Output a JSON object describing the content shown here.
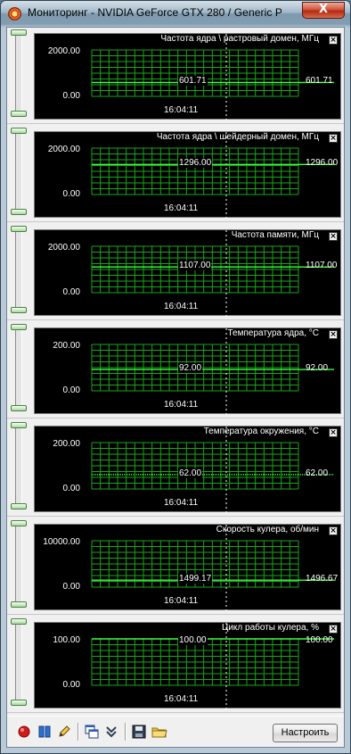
{
  "window": {
    "title": "Мониторинг - NVIDIA GeForce GTX 280 / Generic P...",
    "close_symbol": "X"
  },
  "graphs": [
    {
      "title": "Частота ядра \\ растровый домен, МГц",
      "max": "2000.00",
      "min": "0.00",
      "current": "601.71",
      "right_value": "601.71",
      "time": "16:04:11",
      "line_level": 0.3,
      "cursor_pos": 0.5,
      "dotted": false
    },
    {
      "title": "Частота ядра \\ шейдерный домен, МГц",
      "max": "2000.00",
      "min": "0.00",
      "current": "1296.00",
      "right_value": "1296.00",
      "time": "16:04:11",
      "line_level": 0.648,
      "cursor_pos": 0.5,
      "dotted": false
    },
    {
      "title": "Частота памяти, МГц",
      "max": "2000.00",
      "min": "0.00",
      "current": "1107.00",
      "right_value": "1107.00",
      "time": "16:04:11",
      "line_level": 0.5535,
      "cursor_pos": 0.5,
      "dotted": false
    },
    {
      "title": "Температура ядра, °C",
      "max": "200.00",
      "min": "0.00",
      "current": "92.00",
      "right_value": "92.00",
      "time": "16:04:11",
      "line_level": 0.46,
      "cursor_pos": 0.5,
      "dotted": false
    },
    {
      "title": "Температура окружения, °C",
      "max": "200.00",
      "min": "0.00",
      "current": "62.00",
      "right_value": "62.00",
      "time": "16:04:11",
      "line_level": 0.31,
      "cursor_pos": 0.5,
      "dotted": true
    },
    {
      "title": "Скорость кулера, об/мин",
      "max": "10000.00",
      "min": "0.00",
      "current": "1499.17",
      "right_value": "1496.67",
      "time": "16:04:11",
      "line_level": 0.15,
      "cursor_pos": 0.5,
      "dotted": false
    },
    {
      "title": "Цикл работы кулера, %",
      "max": "100.00",
      "min": "0.00",
      "current": "100.00",
      "right_value": "100.00",
      "time": "16:04:11",
      "line_level": 1.0,
      "cursor_pos": 0.5,
      "dotted": false
    }
  ],
  "colors": {
    "grid": "#1aa61a",
    "line": "#3cff3c",
    "background": "#000000"
  },
  "toolbar": {
    "icons": [
      "record-icon",
      "pause-icon",
      "pencil-icon",
      "windows-icon",
      "collapse-icon",
      "save-icon",
      "folder-icon"
    ],
    "setup_label": "Настроить"
  }
}
